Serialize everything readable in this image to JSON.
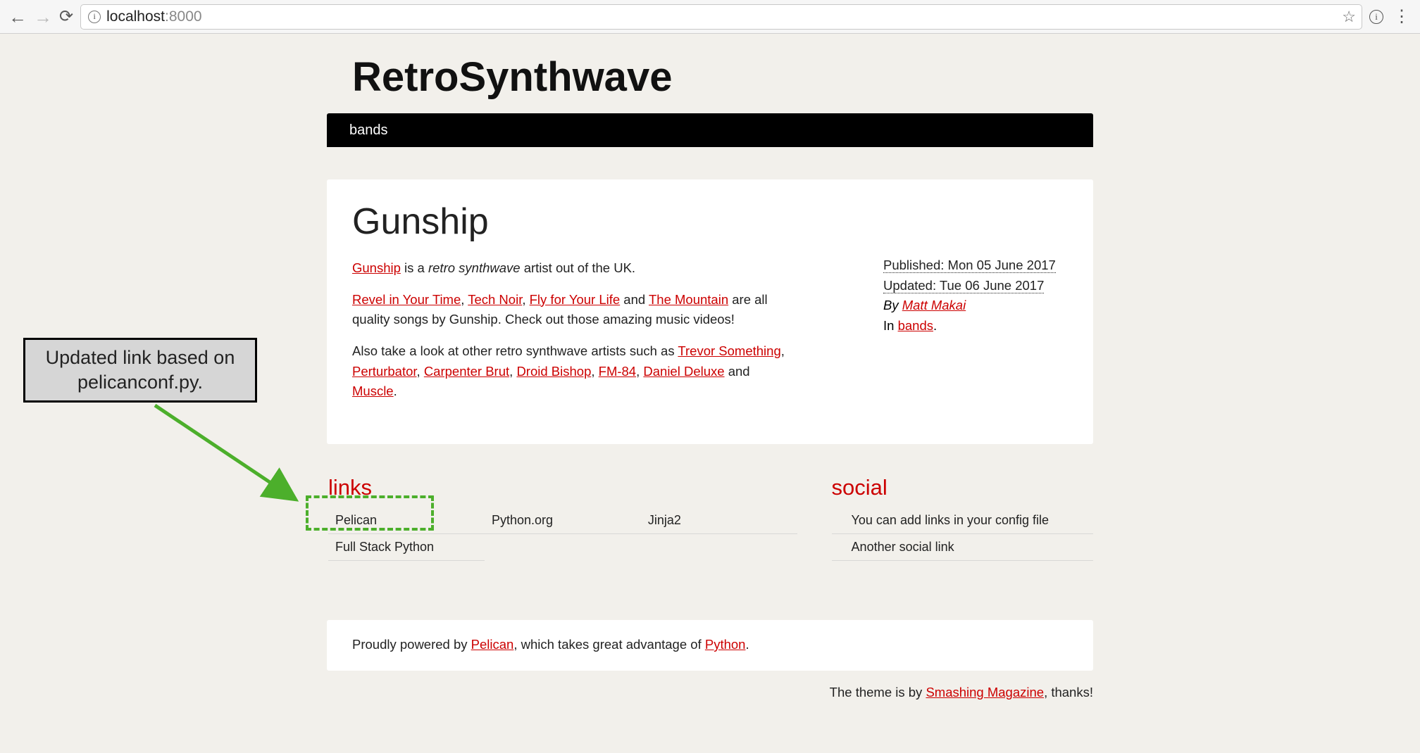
{
  "browser": {
    "url_host": "localhost",
    "url_port": ":8000"
  },
  "site": {
    "title": "RetroSynthwave"
  },
  "nav": {
    "items": [
      {
        "label": "bands"
      }
    ]
  },
  "article": {
    "title": "Gunship",
    "p1": {
      "link0": "Gunship",
      "t1": " is a ",
      "em": "retro synthwave",
      "t2": " artist out of the UK."
    },
    "p2": {
      "link0": "Revel in Your Time",
      "sep0": ", ",
      "link1": "Tech Noir",
      "sep1": ", ",
      "link2": "Fly for Your Life",
      "sep2": " and ",
      "link3": "The Mountain",
      "tail": " are all quality songs by Gunship. Check out those amazing music videos!"
    },
    "p3": {
      "lead": "Also take a look at other retro synthwave artists such as ",
      "link0": "Trevor Something",
      "sep0": ", ",
      "link1": "Perturbator",
      "sep1": ", ",
      "link2": "Carpenter Brut",
      "sep2": ", ",
      "link3": "Droid Bishop",
      "sep3": ", ",
      "link4": "FM-84",
      "sep4": ", ",
      "link5": "Daniel Deluxe",
      "sep5": " and ",
      "link6": "Muscle",
      "tail": "."
    }
  },
  "meta": {
    "published_label": "Published: ",
    "published_value": "Mon 05 June 2017",
    "updated_label": "Updated: ",
    "updated_value": "Tue 06 June 2017",
    "by_label": "By ",
    "author": "Matt Makai",
    "in_label": "In ",
    "category": "bands",
    "period": "."
  },
  "sections": {
    "links_heading": "links",
    "social_heading": "social",
    "links": {
      "col0": [
        {
          "label": "Pelican"
        },
        {
          "label": "Full Stack Python"
        }
      ],
      "col1": [
        {
          "label": "Python.org"
        }
      ],
      "col2": [
        {
          "label": "Jinja2"
        }
      ]
    },
    "social": [
      {
        "label": "You can add links in your config file"
      },
      {
        "label": "Another social link"
      }
    ]
  },
  "footer": {
    "lead": "Proudly powered by ",
    "link0": "Pelican",
    "mid": ", which takes great advantage of ",
    "link1": "Python",
    "tail": "."
  },
  "theme": {
    "lead": "The theme is by ",
    "link": "Smashing Magazine",
    "tail": ", thanks!"
  },
  "annotation": {
    "text": "Updated link based on pelicanconf.py."
  }
}
